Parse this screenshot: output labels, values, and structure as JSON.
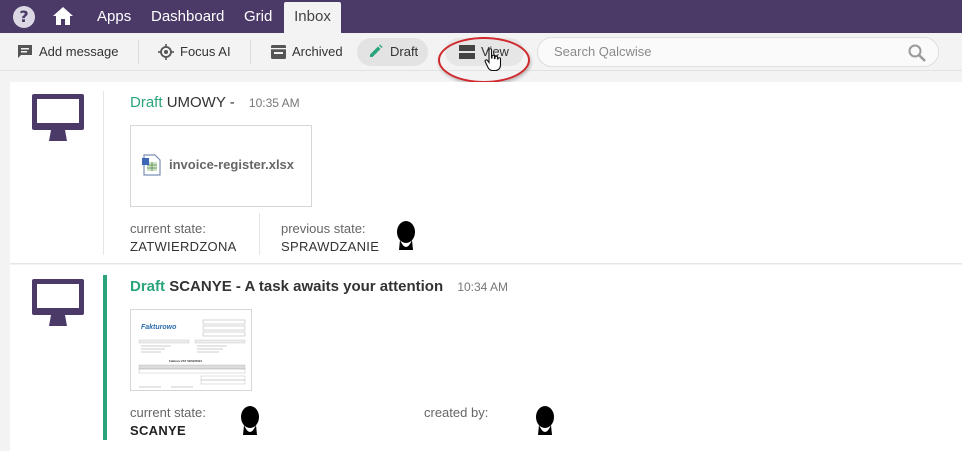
{
  "topbar": {
    "help_icon": "?",
    "home_icon": "home-icon",
    "nav": [
      "Apps",
      "Dashboard",
      "Grid"
    ],
    "active_tab": "Inbox",
    "bg_color": "#4b3a68"
  },
  "toolbar": {
    "add_message": "Add message",
    "focus_ai": "Focus AI",
    "archived": "Archived",
    "draft": "Draft",
    "view": "View",
    "search_placeholder": "Search Qalcwise"
  },
  "messages": [
    {
      "status": "Draft",
      "title": "UMOWY -",
      "time": "10:35 AM",
      "attachment": "invoice-register.xlsx",
      "current_state_label": "current state:",
      "current_state": "ZATWIERDZONA",
      "previous_state_label": "previous state:",
      "previous_state": "SPRAWDZANIE"
    },
    {
      "status": "Draft",
      "title": "SCANYE - A task awaits your attention",
      "time": "10:34 AM",
      "attachment_brand": "Fakturowo",
      "attachment_heading": "Faktura VAT 02/02/2021",
      "current_state_label": "current state:",
      "current_state": "SCANYE",
      "created_by_label": "created by:"
    }
  ],
  "accent_color": "#2aa57a"
}
